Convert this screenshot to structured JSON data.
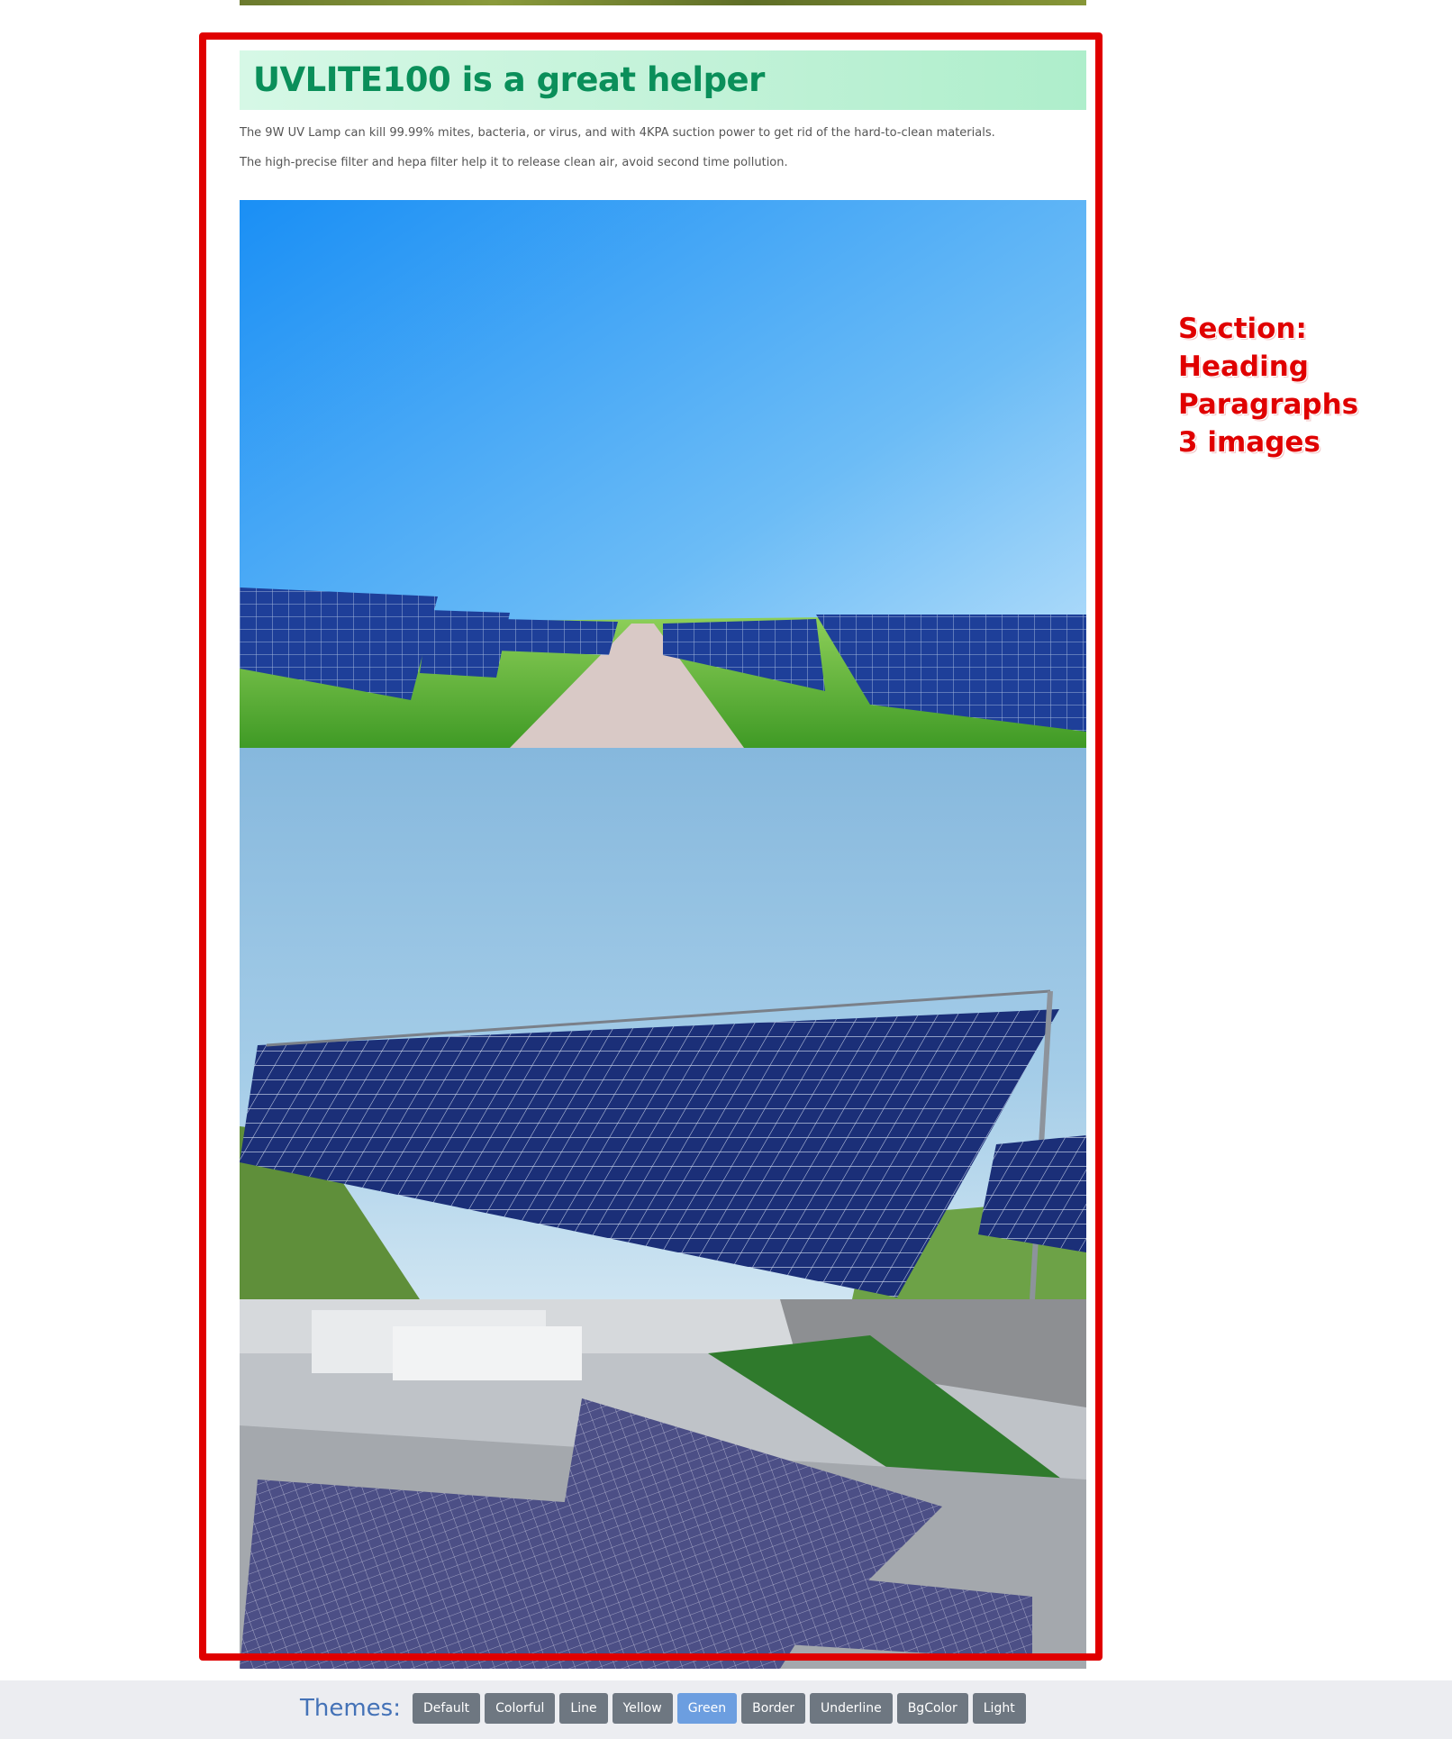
{
  "section": {
    "heading": "UVLITE100 is a great helper",
    "paragraphs": [
      "The 9W UV Lamp can kill 99.99% mites, bacteria, or virus, and with 4KPA suction power to get rid of the hard-to-clean materials.",
      "The high-precise filter and hepa filter help it to release clean air, avoid second time pollution."
    ],
    "images": [
      {
        "alt": "image-1"
      },
      {
        "alt": "image-2"
      },
      {
        "alt": "image-3"
      }
    ]
  },
  "annotation": {
    "lines": [
      "Section:",
      "Heading",
      "Paragraphs",
      "3 images"
    ],
    "color": "#e00000"
  },
  "themes": {
    "label": "Themes:",
    "options": [
      "Default",
      "Colorful",
      "Line",
      "Yellow",
      "Green",
      "Border",
      "Underline",
      "BgColor",
      "Light"
    ],
    "active": "Green",
    "active_color": "#6c9ee0",
    "button_color": "#6e7781"
  },
  "colors": {
    "heading_text": "#0a8f5a",
    "heading_bg": "#c2f2d8",
    "frame": "#e00000"
  }
}
